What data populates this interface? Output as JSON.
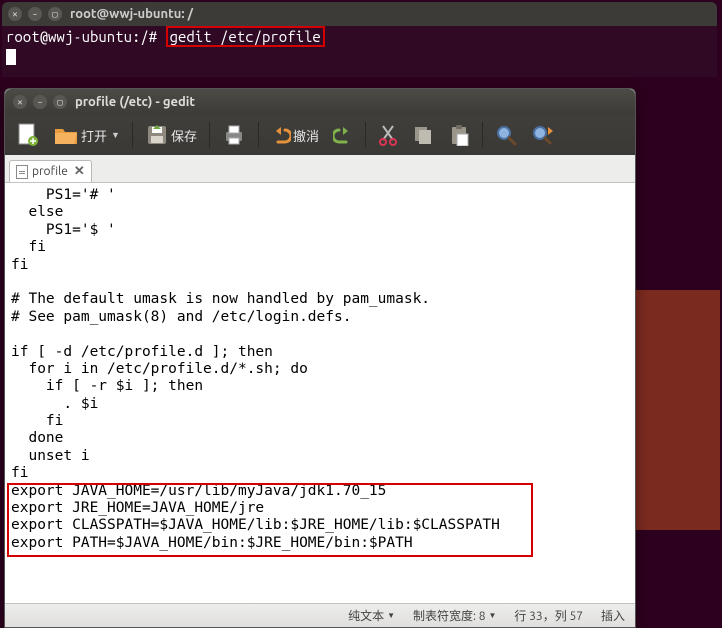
{
  "terminal": {
    "title": "root@wwj-ubuntu: /",
    "prompt": "root@wwj-ubuntu:/#",
    "command": "gedit /etc/profile"
  },
  "gedit": {
    "title": "profile (/etc) - gedit",
    "toolbar": {
      "open": "打开",
      "save": "保存",
      "undo": "撤消"
    },
    "tab": {
      "name": "profile"
    },
    "editor": {
      "prelude": "    PS1='# '\n  else\n    PS1='$ '\n  fi\nfi\n\n# The default umask is now handled by pam_umask.\n# See pam_umask(8) and /etc/login.defs.\n\nif [ -d /etc/profile.d ]; then\n  for i in /etc/profile.d/*.sh; do\n    if [ -r $i ]; then\n      . $i\n    fi\n  done\n  unset i\nfi",
      "fi_line": "fi",
      "exports": "export JAVA_HOME=/usr/lib/myJava/jdk1.70_15\nexport JRE_HOME=JAVA_HOME/jre\nexport CLASSPATH=$JAVA_HOME/lib:$JRE_HOME/lib:$CLASSPATH\nexport PATH=$JAVA_HOME/bin:$JRE_HOME/bin:$PATH"
    },
    "statusbar": {
      "filetype": "纯文本",
      "tabwidth": "制表符宽度: 8",
      "position": "行 33，列 57",
      "mode": "插入"
    }
  }
}
